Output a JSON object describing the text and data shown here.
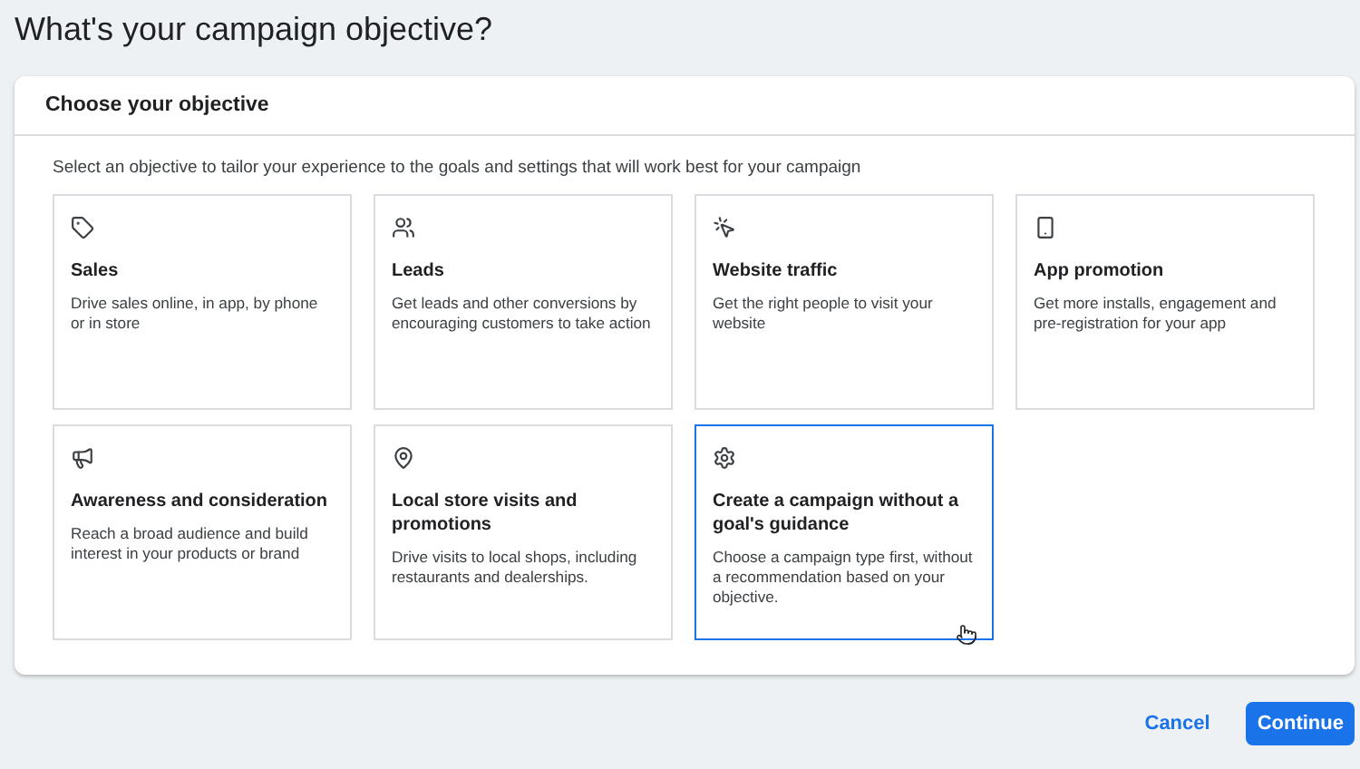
{
  "page_title": "What's your campaign objective?",
  "card": {
    "header": "Choose your objective",
    "description": "Select an objective to tailor your experience to the goals and settings that will work best for your campaign",
    "objectives": [
      {
        "title": "Sales",
        "description": "Drive sales online, in app, by phone or in store",
        "selected": false
      },
      {
        "title": "Leads",
        "description": "Get leads and other conversions by encouraging customers to take action",
        "selected": false
      },
      {
        "title": "Website traffic",
        "description": "Get the right people to visit your website",
        "selected": false
      },
      {
        "title": "App promotion",
        "description": "Get more installs, engagement and pre-registration for your app",
        "selected": false
      },
      {
        "title": "Awareness and consideration",
        "description": "Reach a broad audience and build interest in your products or brand",
        "selected": false
      },
      {
        "title": "Local store visits and promotions",
        "description": "Drive visits to local shops, including restaurants and dealerships.",
        "selected": false
      },
      {
        "title": "Create a campaign without a goal's guidance",
        "description": "Choose a campaign type first, without a recommendation based on your objective.",
        "selected": true
      }
    ]
  },
  "buttons": [
    "Cancel",
    "Continue"
  ]
}
